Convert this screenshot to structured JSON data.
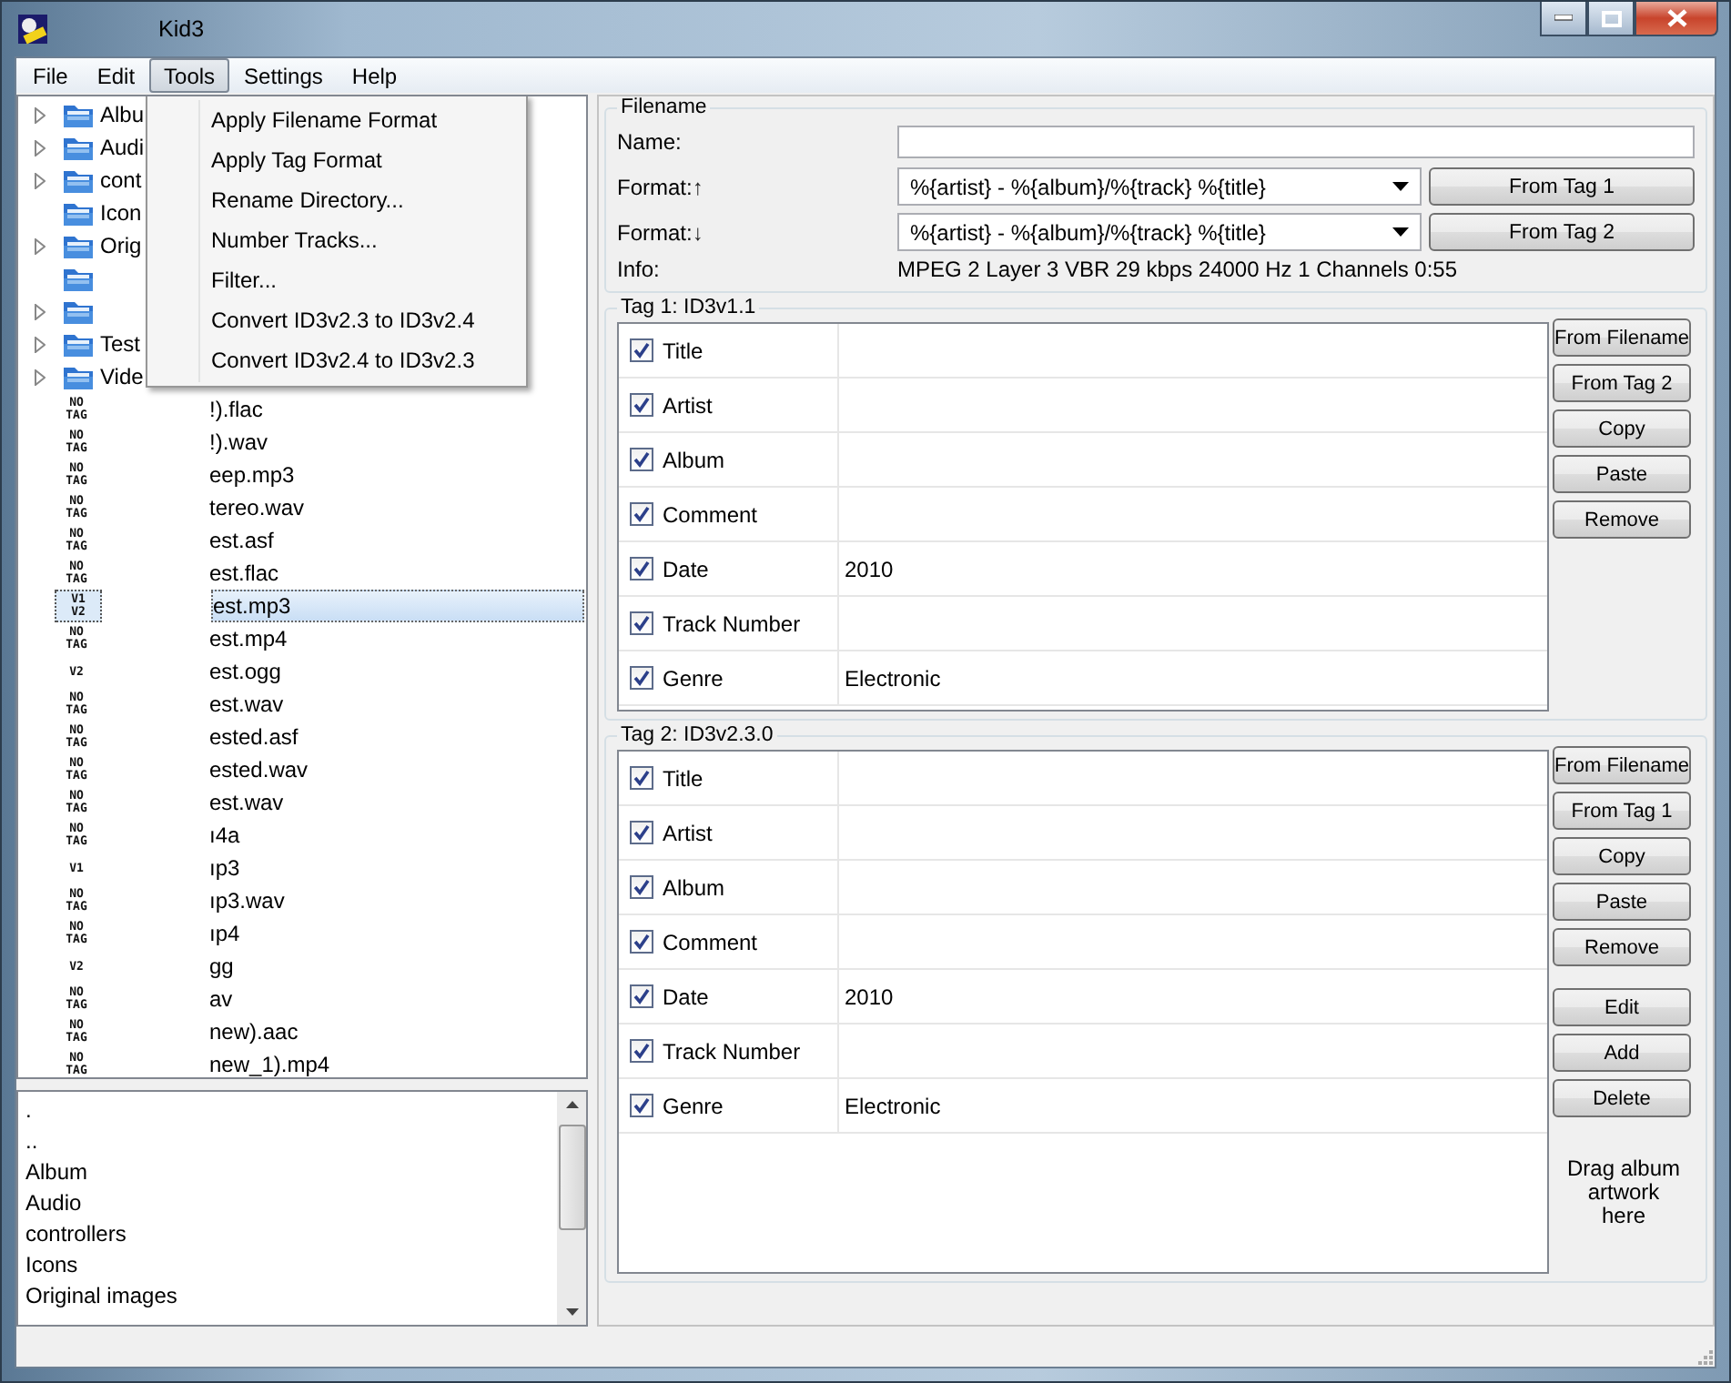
{
  "window": {
    "title": "Kid3"
  },
  "menu_bar": [
    {
      "label": "File",
      "selected": false
    },
    {
      "label": "Edit",
      "selected": false
    },
    {
      "label": "Tools",
      "selected": true
    },
    {
      "label": "Settings",
      "selected": false
    },
    {
      "label": "Help",
      "selected": false
    }
  ],
  "tools_menu": [
    "Apply Filename Format",
    "Apply Tag Format",
    "Rename Directory...",
    "Number Tracks...",
    "Filter...",
    "Convert ID3v2.3 to ID3v2.4",
    "Convert ID3v2.4 to ID3v2.3"
  ],
  "folders": [
    {
      "name": "Albu",
      "expandable": true
    },
    {
      "name": "Audi",
      "expandable": true
    },
    {
      "name": "cont",
      "expandable": true
    },
    {
      "name": "Icon",
      "expandable": false
    },
    {
      "name": "Orig",
      "expandable": true
    },
    {
      "expandable": false
    },
    {
      "expandable": true
    },
    {
      "name": "Test",
      "expandable": true
    },
    {
      "name": "Vide",
      "expandable": true
    }
  ],
  "files": [
    {
      "tag": [
        "NO",
        "TAG"
      ],
      "name": "!).flac",
      "selected": false
    },
    {
      "tag": [
        "NO",
        "TAG"
      ],
      "name": "!).wav",
      "selected": false
    },
    {
      "tag": [
        "NO",
        "TAG"
      ],
      "name": "eep.mp3",
      "selected": false
    },
    {
      "tag": [
        "NO",
        "TAG"
      ],
      "name": "tereo.wav",
      "selected": false
    },
    {
      "tag": [
        "NO",
        "TAG"
      ],
      "name": "est.asf",
      "selected": false
    },
    {
      "tag": [
        "NO",
        "TAG"
      ],
      "name": "est.flac",
      "selected": false
    },
    {
      "tag": [
        "V1",
        "V2"
      ],
      "name": "est.mp3",
      "selected": true
    },
    {
      "tag": [
        "NO",
        "TAG"
      ],
      "name": "est.mp4",
      "selected": false
    },
    {
      "tag": [
        "V2"
      ],
      "name": "est.ogg",
      "selected": false
    },
    {
      "tag": [
        "NO",
        "TAG"
      ],
      "name": "est.wav",
      "selected": false
    },
    {
      "tag": [
        "NO",
        "TAG"
      ],
      "name": "ested.asf",
      "selected": false
    },
    {
      "tag": [
        "NO",
        "TAG"
      ],
      "name": "ested.wav",
      "selected": false
    },
    {
      "tag": [
        "NO",
        "TAG"
      ],
      "name": "est.wav",
      "selected": false
    },
    {
      "tag": [
        "NO",
        "TAG"
      ],
      "name": "ı4a",
      "selected": false
    },
    {
      "tag": [
        "V1"
      ],
      "name": "ıp3",
      "selected": false
    },
    {
      "tag": [
        "NO",
        "TAG"
      ],
      "name": "ıp3.wav",
      "selected": false
    },
    {
      "tag": [
        "NO",
        "TAG"
      ],
      "name": "ıp4",
      "selected": false
    },
    {
      "tag": [
        "V2"
      ],
      "name": "gg",
      "selected": false
    },
    {
      "tag": [
        "NO",
        "TAG"
      ],
      "name": "av",
      "selected": false
    },
    {
      "tag": [
        "NO",
        "TAG"
      ],
      "name": "new).aac",
      "selected": false
    },
    {
      "tag": [
        "NO",
        "TAG"
      ],
      "name": "new_1).mp4",
      "selected": false
    }
  ],
  "directory_list": [
    ".",
    "..",
    "Album",
    "Audio",
    "controllers",
    "Icons",
    "Original images"
  ],
  "filename": {
    "title": "Filename",
    "name_label": "Name:",
    "formats": [
      {
        "label": "Format:",
        "arrow": "↑",
        "value": "%{artist} - %{album}/%{track} %{title}",
        "button": "From Tag 1"
      },
      {
        "label": "Format:",
        "arrow": "↓",
        "value": "%{artist} - %{album}/%{track} %{title}",
        "button": "From Tag 2"
      }
    ],
    "info_label": "Info:",
    "info": "MPEG 2 Layer 3 VBR 29 kbps 24000 Hz 1 Channels 0:55"
  },
  "tags": [
    {
      "title": "Tag 1: ID3v1.1",
      "frames": [
        {
          "name": "Title",
          "checked": true
        },
        {
          "name": "Artist",
          "checked": true
        },
        {
          "name": "Album",
          "checked": true
        },
        {
          "name": "Comment",
          "checked": true
        },
        {
          "name": "Date",
          "value": "2010",
          "checked": true
        },
        {
          "name": "Track Number",
          "checked": true
        },
        {
          "name": "Genre",
          "value": "Electronic",
          "checked": true
        }
      ],
      "buttons": [
        [
          "From Filename",
          "From Tag 2",
          "Copy",
          "Paste",
          "Remove"
        ]
      ]
    },
    {
      "title": "Tag 2: ID3v2.3.0",
      "frames": [
        {
          "name": "Title",
          "checked": true
        },
        {
          "name": "Artist",
          "checked": true
        },
        {
          "name": "Album",
          "checked": true
        },
        {
          "name": "Comment",
          "checked": true
        },
        {
          "name": "Date",
          "value": "2010",
          "checked": true
        },
        {
          "name": "Track Number",
          "checked": true
        },
        {
          "name": "Genre",
          "value": "Electronic",
          "checked": true
        }
      ],
      "buttons": [
        [
          "From Filename",
          "From Tag 1",
          "Copy",
          "Paste",
          "Remove"
        ],
        [
          "Edit",
          "Add",
          "Delete"
        ]
      ],
      "artwork_hint": "Drag album artwork here"
    }
  ]
}
